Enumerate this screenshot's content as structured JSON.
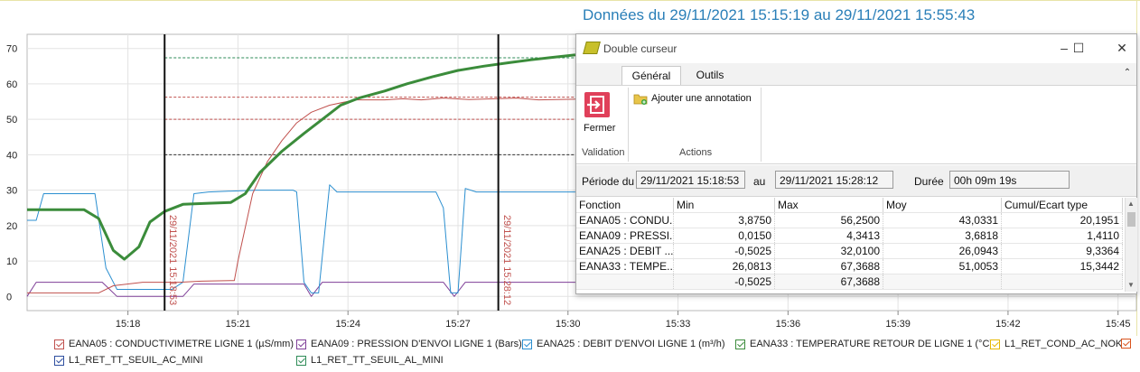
{
  "chart_title": "Données du 29/11/2021 15:15:19 au 29/11/2021 15:55:43",
  "chart_data": {
    "type": "line",
    "yticks": [
      "0",
      "10",
      "20",
      "30",
      "40",
      "50",
      "60",
      "70"
    ],
    "ylim": [
      -4,
      74
    ],
    "xticks": [
      "15:18",
      "15:21",
      "15:24",
      "15:27",
      "15:30",
      "15:33",
      "15:36",
      "15:39",
      "15:42",
      "15:45"
    ],
    "xlim_minutes": [
      15.25,
      45.5
    ],
    "cursors": [
      {
        "time_min": 19.0,
        "label": "29/11/2021 15:18:53"
      },
      {
        "time_min": 28.1,
        "label": "29/11/2021 15:28:12"
      }
    ],
    "reference_lines": [
      {
        "y": 67.3688,
        "color": "#2e8b57"
      },
      {
        "y": 56.25,
        "color": "#c0504d"
      },
      {
        "y": 50.0,
        "color": "#c0504d"
      },
      {
        "y": 40.0,
        "color": "#333333"
      }
    ],
    "series": [
      {
        "name": "EANA33 : TEMPERATURE RETOUR DE LIGNE 1 (°C)",
        "color": "#3b8c3b",
        "width": 3,
        "points": [
          [
            15.25,
            24.5
          ],
          [
            16.8,
            24.5
          ],
          [
            17.2,
            22
          ],
          [
            17.6,
            13
          ],
          [
            17.9,
            10.5
          ],
          [
            18.3,
            14
          ],
          [
            18.6,
            21
          ],
          [
            19.0,
            24
          ],
          [
            19.5,
            26
          ],
          [
            20.2,
            26.3
          ],
          [
            20.8,
            26.5
          ],
          [
            21.2,
            29
          ],
          [
            21.6,
            35
          ],
          [
            22.2,
            41
          ],
          [
            22.8,
            46
          ],
          [
            23.3,
            50
          ],
          [
            23.8,
            54
          ],
          [
            24.3,
            56
          ],
          [
            25.0,
            58
          ],
          [
            25.6,
            60
          ],
          [
            26.3,
            62
          ],
          [
            27.0,
            63.8
          ],
          [
            27.7,
            65
          ],
          [
            28.4,
            66
          ],
          [
            29.0,
            66.8
          ],
          [
            29.5,
            67.4
          ],
          [
            30.2,
            68.2
          ]
        ]
      },
      {
        "name": "EANA05 : CONDUCTIVIMETRE LIGNE 1 (µS/mm)",
        "color": "#c0504d",
        "width": 1,
        "points": [
          [
            15.25,
            1
          ],
          [
            17.2,
            1
          ],
          [
            17.6,
            3
          ],
          [
            18.4,
            4
          ],
          [
            19.4,
            4
          ],
          [
            20.0,
            4.3
          ],
          [
            20.9,
            4.5
          ],
          [
            21.0,
            10
          ],
          [
            21.4,
            29
          ],
          [
            21.8,
            38
          ],
          [
            22.2,
            44
          ],
          [
            22.6,
            49
          ],
          [
            23.0,
            52
          ],
          [
            23.5,
            54
          ],
          [
            24.2,
            55.5
          ],
          [
            25.0,
            55.5
          ],
          [
            25.5,
            55.8
          ],
          [
            26.0,
            55.5
          ],
          [
            26.6,
            56
          ],
          [
            27.3,
            55.6
          ],
          [
            28.0,
            55.8
          ],
          [
            28.6,
            56
          ],
          [
            29.2,
            55.5
          ],
          [
            30.2,
            55.7
          ]
        ]
      },
      {
        "name": "EANA25 : DEBIT D'ENVOI LIGNE 1 (m³/h)",
        "color": "#2b8fd0",
        "width": 1,
        "points": [
          [
            15.25,
            21.5
          ],
          [
            15.5,
            21.5
          ],
          [
            15.7,
            29
          ],
          [
            17.1,
            29
          ],
          [
            17.4,
            8
          ],
          [
            17.7,
            2
          ],
          [
            18.0,
            2
          ],
          [
            18.5,
            2
          ],
          [
            19.2,
            2
          ],
          [
            19.5,
            4
          ],
          [
            19.8,
            29
          ],
          [
            20.2,
            29.5
          ],
          [
            21.5,
            30
          ],
          [
            22.5,
            30
          ],
          [
            22.6,
            29.5
          ],
          [
            22.8,
            4
          ],
          [
            23.0,
            1
          ],
          [
            23.2,
            1
          ],
          [
            23.5,
            31.5
          ],
          [
            23.7,
            29.5
          ],
          [
            26.4,
            29.5
          ],
          [
            26.6,
            25
          ],
          [
            26.8,
            1
          ],
          [
            27.0,
            1
          ],
          [
            27.2,
            30.5
          ],
          [
            27.5,
            29.5
          ],
          [
            30.2,
            29.5
          ]
        ]
      },
      {
        "name": "EANA09 : PRESSION D'ENVOI LIGNE 1 (Bars)",
        "color": "#7f3f98",
        "width": 1,
        "points": [
          [
            15.25,
            0
          ],
          [
            15.5,
            4
          ],
          [
            17.3,
            4
          ],
          [
            17.7,
            0
          ],
          [
            19.5,
            0
          ],
          [
            19.8,
            3.5
          ],
          [
            22.8,
            3.5
          ],
          [
            23.0,
            0
          ],
          [
            23.3,
            4
          ],
          [
            26.6,
            4
          ],
          [
            26.9,
            0
          ],
          [
            27.2,
            4
          ],
          [
            30.2,
            4
          ]
        ]
      }
    ]
  },
  "legend": [
    {
      "label": "EANA05 : CONDUCTIVIMETRE LIGNE 1 (µS/mm)",
      "color": "#c0504d"
    },
    {
      "label": "EANA09 : PRESSION D'ENVOI LIGNE 1 (Bars)",
      "color": "#7f3f98"
    },
    {
      "label": "EANA25 : DEBIT D'ENVOI LIGNE 1 (m³/h)",
      "color": "#2b8fd0"
    },
    {
      "label": "EANA33 : TEMPERATURE RETOUR DE LIGNE 1 (°C)",
      "color": "#3b8c3b"
    },
    {
      "label": "L1_RET_COND_AC_NOK",
      "color": "#e6b800"
    },
    {
      "label": "",
      "color": "#d9541e"
    },
    {
      "label": "L1_RET_TT_SEUIL_AC_MINI",
      "color": "#2f4f9f"
    },
    {
      "label": "L1_RET_TT_SEUIL_AL_MINI",
      "color": "#2e8b57"
    }
  ],
  "dialog": {
    "title": "Double curseur",
    "tabs": [
      "Général",
      "Outils"
    ],
    "fermer": "Fermer",
    "annotation": "Ajouter une annotation",
    "group_validation": "Validation",
    "group_actions": "Actions",
    "periode_label": "Période du",
    "periode_from": "29/11/2021 15:18:53",
    "au_label": "au",
    "periode_to": "29/11/2021 15:28:12",
    "duree_label": "Durée",
    "duree": "00h 09m 19s",
    "columns": [
      "Fonction",
      "Min",
      "Max",
      "Moy",
      "Cumul/Ecart type"
    ],
    "rows": [
      [
        "EANA05 : CONDU...",
        "3,8750",
        "56,2500",
        "43,0331",
        "20,1951"
      ],
      [
        "EANA09 : PRESSI...",
        "0,0150",
        "4,3413",
        "3,6818",
        "1,4110"
      ],
      [
        "EANA25 : DEBIT ...",
        "-0,5025",
        "32,0100",
        "26,0943",
        "9,3364"
      ],
      [
        "EANA33 : TEMPE...",
        "26,0813",
        "67,3688",
        "51,0053",
        "15,3442"
      ],
      [
        "",
        "-0,5025",
        "67,3688",
        "",
        ""
      ]
    ]
  }
}
